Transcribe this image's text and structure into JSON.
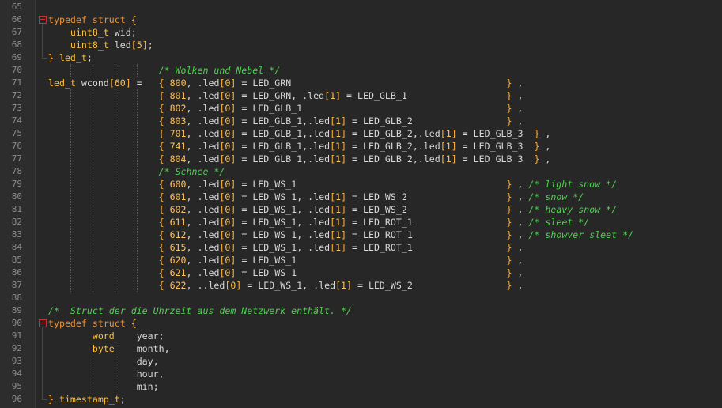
{
  "editor": {
    "lines": [
      {
        "n": "65",
        "code": ""
      },
      {
        "n": "66",
        "code": "typedef struct {",
        "fold": "open"
      },
      {
        "n": "67",
        "code": "    uint8_t wid;"
      },
      {
        "n": "68",
        "code": "    uint8_t led[5];"
      },
      {
        "n": "69",
        "code": "} led_t;",
        "fold": "end"
      },
      {
        "n": "70",
        "code": "                    /* Wolken und Nebel */"
      },
      {
        "n": "71",
        "code": "led_t wcond[60] =   { 800, .led[0] = LED_GRN                                       } ,"
      },
      {
        "n": "72",
        "code": "                    { 801, .led[0] = LED_GRN, .led[1] = LED_GLB_1                  } ,"
      },
      {
        "n": "73",
        "code": "                    { 802, .led[0] = LED_GLB_1                                     } ,"
      },
      {
        "n": "74",
        "code": "                    { 803, .led[0] = LED_GLB_1,.led[1] = LED_GLB_2                 } ,"
      },
      {
        "n": "75",
        "code": "                    { 701, .led[0] = LED_GLB_1,.led[1] = LED_GLB_2,.led[1] = LED_GLB_3  } ,"
      },
      {
        "n": "76",
        "code": "                    { 741, .led[0] = LED_GLB_1,.led[1] = LED_GLB_2,.led[1] = LED_GLB_3  } ,"
      },
      {
        "n": "77",
        "code": "                    { 804, .led[0] = LED_GLB_1,.led[1] = LED_GLB_2,.led[1] = LED_GLB_3  } ,"
      },
      {
        "n": "78",
        "code": "                    /* Schnee */"
      },
      {
        "n": "79",
        "code": "                    { 600, .led[0] = LED_WS_1                                      } , /* light snow */"
      },
      {
        "n": "80",
        "code": "                    { 601, .led[0] = LED_WS_1, .led[1] = LED_WS_2                  } , /* snow */"
      },
      {
        "n": "81",
        "code": "                    { 602, .led[0] = LED_WS_1, .led[1] = LED_WS_2                  } , /* heavy snow */"
      },
      {
        "n": "82",
        "code": "                    { 611, .led[0] = LED_WS_1, .led[1] = LED_ROT_1                 } , /* sleet */"
      },
      {
        "n": "83",
        "code": "                    { 612, .led[0] = LED_WS_1, .led[1] = LED_ROT_1                 } , /* showver sleet */"
      },
      {
        "n": "84",
        "code": "                    { 615, .led[0] = LED_WS_1, .led[1] = LED_ROT_1                 } ,"
      },
      {
        "n": "85",
        "code": "                    { 620, .led[0] = LED_WS_1                                      } ,"
      },
      {
        "n": "86",
        "code": "                    { 621, .led[0] = LED_WS_1                                      } ,"
      },
      {
        "n": "87",
        "code": "                    { 622, ..led[0] = LED_WS_1, .led[1] = LED_WS_2                 } ,"
      },
      {
        "n": "88",
        "code": ""
      },
      {
        "n": "89",
        "code": "/*  Struct der die Uhrzeit aus dem Netzwerk enthält. */"
      },
      {
        "n": "90",
        "code": "typedef struct {",
        "fold": "open"
      },
      {
        "n": "91",
        "code": "        word    year;"
      },
      {
        "n": "92",
        "code": "        byte    month,"
      },
      {
        "n": "93",
        "code": "                day,"
      },
      {
        "n": "94",
        "code": "                hour,"
      },
      {
        "n": "95",
        "code": "                min;"
      },
      {
        "n": "96",
        "code": "} timestamp_t;",
        "fold": "end"
      }
    ]
  },
  "theme": {
    "background": "#272727",
    "gutter": "#2d2d2d",
    "line_number": "#8b8b8b",
    "keyword": "#e8913a",
    "type": "#ffbf33",
    "comment": "#4fd24f",
    "text": "#d8d8d8",
    "fold_marker": "#c9303a"
  }
}
